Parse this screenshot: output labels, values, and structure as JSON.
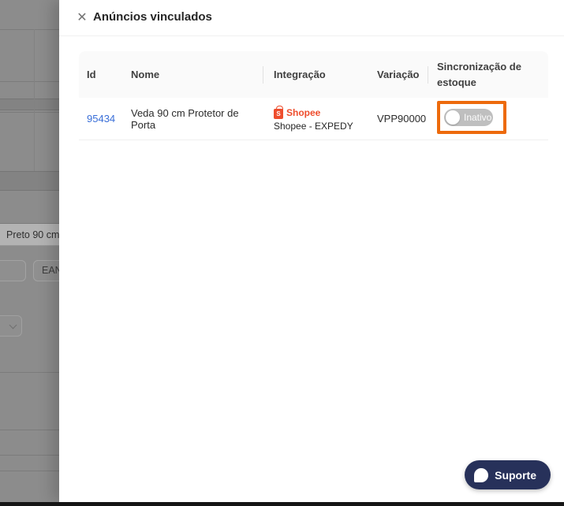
{
  "drawer": {
    "title": "Anúncios vinculados"
  },
  "icons": {
    "close": "✕"
  },
  "table": {
    "columns": {
      "id": "Id",
      "nome": "Nome",
      "integracao": "Integração",
      "variacao": "Variação",
      "sincronizacao": "Sincronização de estoque"
    },
    "row": {
      "id": "95434",
      "nome": "Veda 90 cm Protetor de Porta",
      "integracao_platform": "Shopee",
      "integracao_platform_initial": "S",
      "integracao_account": "Shopee - EXPEDY",
      "variacao": "VPP90000",
      "sync_state": "Inativo",
      "sync_enabled": false
    }
  },
  "support": {
    "label": "Suporte"
  },
  "underlying_page": {
    "variant_option": "Preto 90 cm",
    "ean_button": "EAN"
  },
  "colors": {
    "highlight_orange": "#ed6a0c",
    "shopee_orange": "#ee4d2d",
    "link_blue": "#3a6fd8",
    "support_navy": "#27315a",
    "toggle_track": "#bfbfbf",
    "mask_gray": "#8c8c8c",
    "table_header_bg": "#fafafa"
  }
}
